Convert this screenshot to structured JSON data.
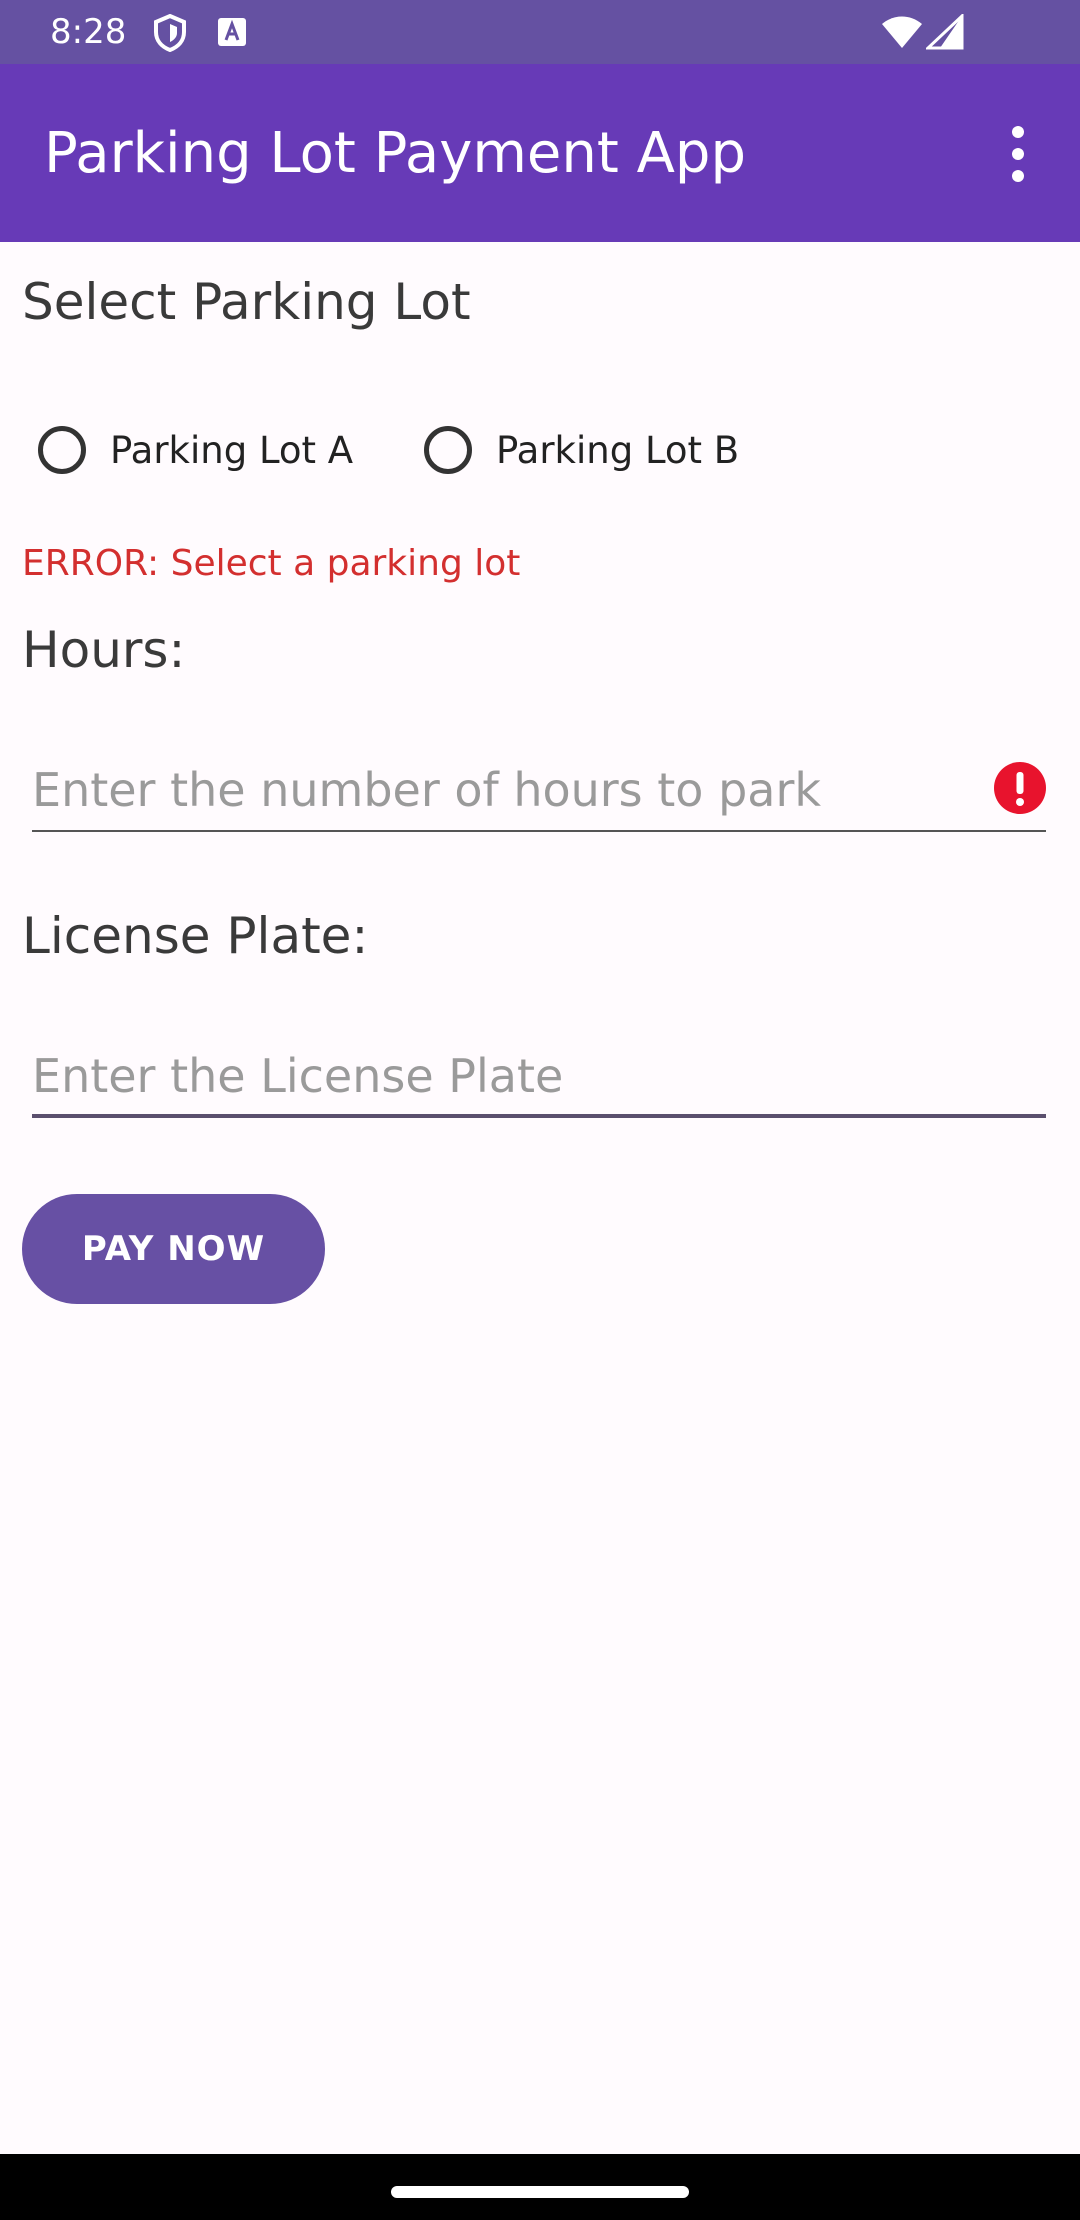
{
  "status_bar": {
    "time": "8:28",
    "icons": [
      "shield-icon",
      "a-notification-icon",
      "wifi-icon",
      "signal-icon"
    ]
  },
  "app_bar": {
    "title": "Parking Lot Payment App",
    "menu_icon": "more-vert-icon"
  },
  "form": {
    "lot_section_label": "Select Parking Lot",
    "lots": [
      {
        "label": "Parking Lot A",
        "selected": false
      },
      {
        "label": "Parking Lot B",
        "selected": false
      }
    ],
    "lot_error": "ERROR: Select a parking lot",
    "hours_label": "Hours:",
    "hours_value": "",
    "hours_placeholder": "Enter the number of hours to park",
    "hours_error_icon": "error-icon",
    "plate_label": "License Plate:",
    "plate_value": "",
    "plate_placeholder": "Enter the License Plate",
    "pay_button": "PAY NOW"
  },
  "colors": {
    "status_bar": "#6551a2",
    "app_bar": "#673ab7",
    "button": "#6750a4",
    "error": "#d32f2f",
    "background": "#fffbfe"
  }
}
